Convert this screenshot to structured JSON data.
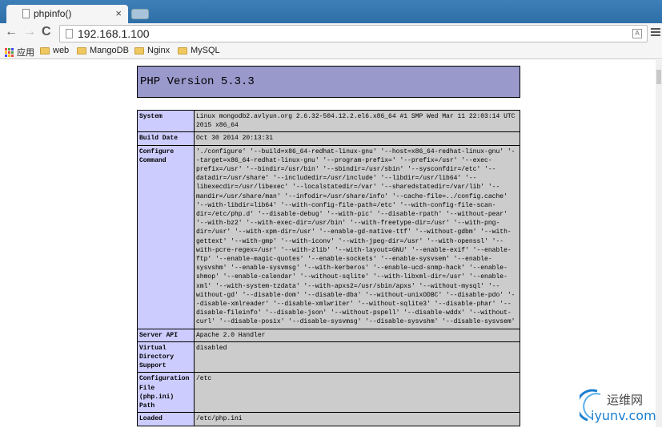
{
  "browser": {
    "tab_title": "phpinfo()",
    "url": "192.168.1.100",
    "bookmarks": [
      "应用",
      "web",
      "MangoDB",
      "Nginx",
      "MySQL"
    ]
  },
  "php": {
    "title": "PHP Version 5.3.3",
    "rows": [
      {
        "label": [
          "System"
        ],
        "value": [
          "Linux mongodb2.avlyun.org 2.6.32-504.12.2.el6.x86_64 #1 SMP Wed Mar 11 22:03:14 UTC",
          "2015 x86_64"
        ]
      },
      {
        "label": [
          "Build Date"
        ],
        "value": [
          "Oct 30 2014 20:13:31"
        ]
      },
      {
        "label": [
          "Configure",
          "Command"
        ],
        "value": [
          "'./configure' '--build=x86_64-redhat-linux-gnu' '--host=x86_64-redhat-linux-gnu' '-",
          "-target=x86_64-redhat-linux-gnu' '--program-prefix=' '--prefix=/usr' '--exec-",
          "prefix=/usr' '--bindir=/usr/bin' '--sbindir=/usr/sbin' '--sysconfdir=/etc' '--",
          "datadir=/usr/share' '--includedir=/usr/include' '--libdir=/usr/lib64' '--",
          "libexecdir=/usr/libexec' '--localstatedir=/var' '--sharedstatedir=/var/lib' '--",
          "mandir=/usr/share/man' '--infodir=/usr/share/info' '--cache-file=../config.cache'",
          "'--with-libdir=lib64' '--with-config-file-path=/etc' '--with-config-file-scan-",
          "dir=/etc/php.d' '--disable-debug' '--with-pic' '--disable-rpath' '--without-pear'",
          "'--with-bz2' '--with-exec-dir=/usr/bin' '--with-freetype-dir=/usr' '--with-png-",
          "dir=/usr' '--with-xpm-dir=/usr' '--enable-gd-native-ttf' '--without-gdbm' '--with-",
          "gettext' '--with-gmp' '--with-iconv' '--with-jpeg-dir=/usr' '--with-openssl' '--",
          "with-pcre-regex=/usr' '--with-zlib' '--with-layout=GNU' '--enable-exif' '--enable-",
          "ftp' '--enable-magic-quotes' '--enable-sockets' '--enable-sysvsem' '--enable-",
          "sysvshm' '--enable-sysvmsg' '--with-kerberos' '--enable-ucd-snmp-hack' '--enable-",
          "shmop' '--enable-calendar' '--without-sqlite' '--with-libxml-dir=/usr' '--enable-",
          "xml' '--with-system-tzdata' '--with-apxs2=/usr/sbin/apxs' '--without-mysql' '--",
          "without-gd' '--disable-dom' '--disable-dba' '--without-unixODBC' '--disable-pdo' '-",
          "-disable-xmlreader' '--disable-xmlwriter' '--without-sqlite3' '--disable-phar' '--",
          "disable-fileinfo' '--disable-json' '--without-pspell' '--disable-wddx' '--without-",
          "curl' '--disable-posix' '--disable-sysvmsg' '--disable-sysvshm' '--disable-sysvsem'"
        ]
      },
      {
        "label": [
          "Server API"
        ],
        "value": [
          "Apache 2.0 Handler"
        ]
      },
      {
        "label": [
          "Virtual",
          "Directory",
          "Support"
        ],
        "value": [
          "disabled"
        ]
      },
      {
        "label": [
          "Configuration",
          "File",
          "(php.ini)",
          "Path"
        ],
        "value": [
          "/etc"
        ]
      },
      {
        "label": [
          "Loaded"
        ],
        "value": [
          "/etc/php.ini"
        ]
      }
    ]
  },
  "watermark": {
    "text": "运维网",
    "domain": "iyunv.com",
    "color": "#1a7fd0"
  }
}
